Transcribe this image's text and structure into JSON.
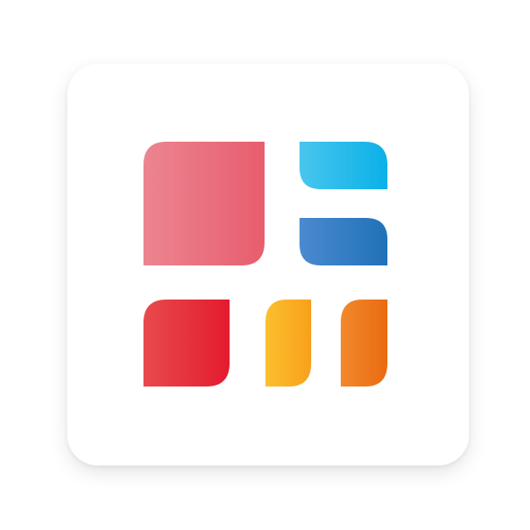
{
  "icon": {
    "name": "app-launcher-tile-icon",
    "background_color": "#ffffff",
    "tiles": [
      {
        "name": "large-pink-tile",
        "gradient": [
          "#ec8590",
          "#e85d6e"
        ]
      },
      {
        "name": "cyan-tile",
        "gradient": [
          "#48c6ee",
          "#0ab1e8"
        ]
      },
      {
        "name": "blue-tile",
        "gradient": [
          "#4a8ad0",
          "#2171b8"
        ]
      },
      {
        "name": "red-tile",
        "gradient": [
          "#e84a4d",
          "#e31b2e"
        ]
      },
      {
        "name": "yellow-tile",
        "gradient": [
          "#fbc02d",
          "#f8a01c"
        ]
      },
      {
        "name": "orange-tile",
        "gradient": [
          "#f2892b",
          "#ea6b10"
        ]
      }
    ]
  }
}
